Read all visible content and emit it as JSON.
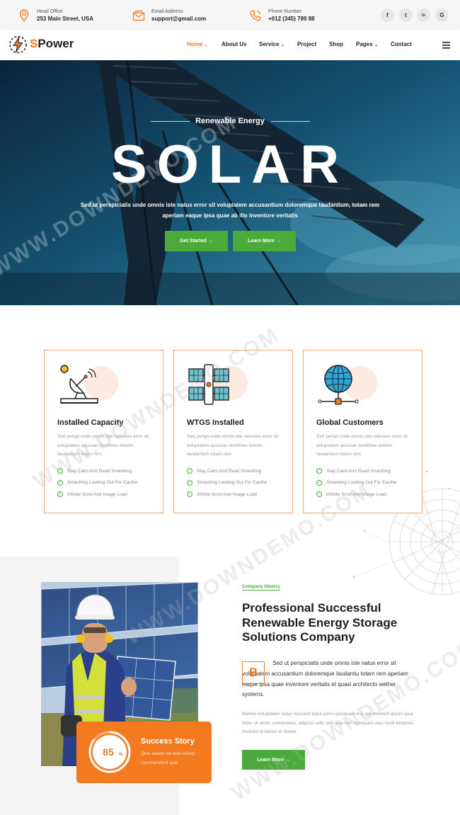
{
  "topbar": {
    "office": {
      "label": "Head Office",
      "value": "253 Main Street, USA"
    },
    "email": {
      "label": "Email Address",
      "value": "support@gmail.com"
    },
    "phone": {
      "label": "Phone Number",
      "value": "+012 (345) 789 88"
    },
    "social": [
      "f",
      "t",
      "in",
      "G"
    ]
  },
  "nav": {
    "logo_first": "S",
    "logo_rest": "Power",
    "items": [
      "Home",
      "About Us",
      "Service",
      "Project",
      "Shop",
      "Pages",
      "Contact"
    ],
    "active": "Home"
  },
  "hero": {
    "subtitle": "Renewable Energy",
    "title": "SOLAR",
    "text": "Sed ut perspiciatis unde omnis iste natus error sit voluptatem accusantium doloremque laudantium, totam rem aperiam eaque ipsa quae ab illo inventore veritatis",
    "btn_primary": "Get Started →",
    "btn_secondary": "Learn More →"
  },
  "features": [
    {
      "title": "Installed Capacity",
      "icon": "satellite-dish-icon",
      "text": "Sed perspi unde omnis iste natusers error sit voluptatem accusan tiumthew dolorm laudantium totam rem",
      "items": [
        "Stay Calm And Read Smashing",
        "Smashing Looking Out For Eacthe",
        "Infinite Scrol And Image Load"
      ]
    },
    {
      "title": "WTGS Installed",
      "icon": "solar-satellite-icon",
      "text": "Sed perspi unde omnis iste natusers error sit voluptatem accusan tiumthew dolorm laudantium totam rem",
      "items": [
        "Stay Calm And Read Smashing",
        "Smashing Looking Out For Eacthe",
        "Infinite Scrol And Image Load"
      ]
    },
    {
      "title": "Global Customers",
      "icon": "globe-network-icon",
      "text": "Sed perspi unde omnis iste natusers error sit voluptatem accusan tiumthew dolorm laudantium totam rem",
      "items": [
        "Stay Calm And Read Smashing",
        "Smashing Looking Out For Eacthe",
        "Infinite Scrol And Image Load"
      ]
    }
  ],
  "about": {
    "tag": "Company History",
    "heading": "Professional Successful Renewable Energy Storage Solutions Company",
    "dropcap": "B",
    "para1": "Sed ut perspiciatis unde omnis iste natus error sit voluptatem accusantium doloremque laudantiu totam rem aperiam eaque ipsa quae inventore veritatis et quasi architecto wether systems.",
    "para2": "Batiine voluptatem sequi nesciunt eque porro quisquam est, qui dolorem ipsum quia dolor sit amet, consectetur, adipisci velit, sed quia non numquam eius modi tempora incidunt ut labore et dolore",
    "button": "Learn More →",
    "story": {
      "percent": "85",
      "percent_sign": "%",
      "progress": 0.85,
      "title": "Success Story",
      "text": "Quis autem vel eum iurerp reprehenderit quie"
    }
  },
  "watermark": "WWW.DOWNDEMO.COM",
  "colors": {
    "accent": "#f47a20",
    "green": "#4aab3b"
  }
}
